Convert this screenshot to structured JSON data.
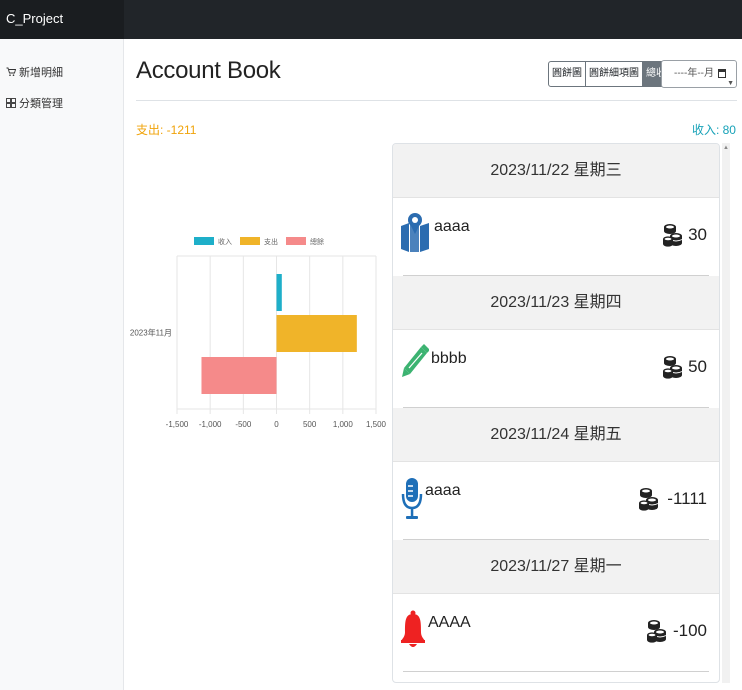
{
  "app": {
    "brand": "C_Project"
  },
  "sidebar": {
    "items": [
      {
        "label": "新增明細",
        "icon": "cart-icon"
      },
      {
        "label": "分類管理",
        "icon": "category-icon"
      }
    ]
  },
  "header": {
    "title": "Account Book",
    "view_buttons": [
      "圓餅圖",
      "圓餅細項圖",
      "總收支"
    ],
    "active_view": "總收支",
    "month_placeholder": "----年--月"
  },
  "summary": {
    "expense_label": "支出: -1211",
    "income_label": "收入: 80",
    "expense_color": "#f0a30a",
    "income_color": "#17a2b8"
  },
  "chart_data": {
    "type": "bar",
    "orientation": "horizontal",
    "categories": [
      "2023年11月"
    ],
    "series": [
      {
        "name": "收入",
        "values": [
          80
        ],
        "color": "#1eafc9"
      },
      {
        "name": "支出",
        "values": [
          1211
        ],
        "color": "#f0b429"
      },
      {
        "name": "總餘",
        "values": [
          -1131
        ],
        "color": "#f58a8a"
      }
    ],
    "xlim": [
      -1500,
      1500
    ],
    "xticks": [
      "-1,500",
      "-1,000",
      "-500",
      "0",
      "500",
      "1,000",
      "1,500"
    ],
    "grid": true,
    "legend": "top"
  },
  "days": [
    {
      "date": "2023/11/22 星期三",
      "entries": [
        {
          "name": "aaaa",
          "icon": "map-icon",
          "amount": "30",
          "color": "#2b6cb0"
        }
      ]
    },
    {
      "date": "2023/11/23 星期四",
      "entries": [
        {
          "name": "bbbb",
          "icon": "pencil-icon",
          "amount": "50",
          "color": "#3cb371"
        }
      ]
    },
    {
      "date": "2023/11/24 星期五",
      "entries": [
        {
          "name": "aaaa",
          "icon": "microphone-icon",
          "amount": "-1111",
          "color": "#1e6fb8"
        }
      ]
    },
    {
      "date": "2023/11/27 星期一",
      "entries": [
        {
          "name": "AAAA",
          "icon": "bell-icon",
          "amount": "-100",
          "color": "#ee2222"
        }
      ]
    }
  ]
}
